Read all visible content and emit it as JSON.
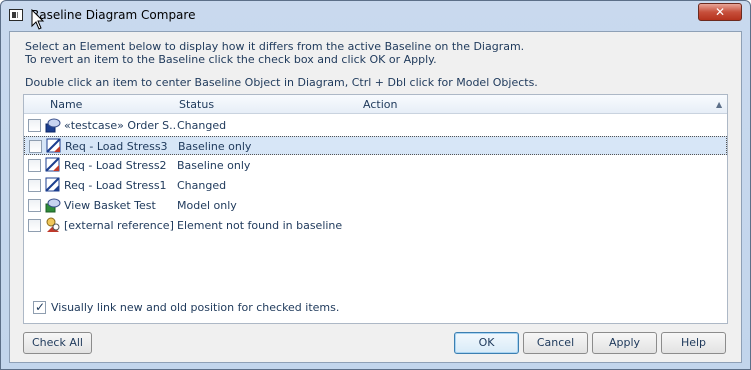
{
  "window": {
    "title": "Baseline Diagram Compare",
    "close_glyph": "✕"
  },
  "instructions": {
    "line1": "Select an Element below to display how it differs from the active Baseline on the Diagram.",
    "line2": "To revert an item to the Baseline click the check box and click OK or Apply.",
    "line3": "Double click an item to center Baseline Object in Diagram, Ctrl + Dbl click for Model Objects."
  },
  "list": {
    "columns": [
      "Name",
      "Status",
      "Action"
    ],
    "rows": [
      {
        "name": "«testcase» Order S...",
        "status": "Changed",
        "icon": "testcase-icon",
        "checked": false,
        "selected": false
      },
      {
        "name": "Req - Load Stress3",
        "status": "Baseline only",
        "icon": "requirement-icon",
        "checked": false,
        "selected": true
      },
      {
        "name": "Req - Load Stress2",
        "status": "Baseline only",
        "icon": "requirement-icon",
        "checked": false,
        "selected": false
      },
      {
        "name": "Req - Load Stress1",
        "status": "Changed",
        "icon": "requirement-icon",
        "checked": false,
        "selected": false
      },
      {
        "name": "View Basket Test",
        "status": "Model only",
        "icon": "testcase-icon",
        "checked": false,
        "selected": false
      },
      {
        "name": "[external reference]",
        "status": "Element not found in baseline",
        "icon": "external-reference-icon",
        "checked": false,
        "selected": false
      }
    ]
  },
  "option": {
    "label": "Visually link new and old position for checked items.",
    "checked": true
  },
  "buttons": {
    "check_all": "Check All",
    "ok": "OK",
    "cancel": "Cancel",
    "apply": "Apply",
    "help": "Help"
  },
  "colors": {
    "text": "#1e395b",
    "selection": "#d7e6f7",
    "close": "#c7503c"
  }
}
